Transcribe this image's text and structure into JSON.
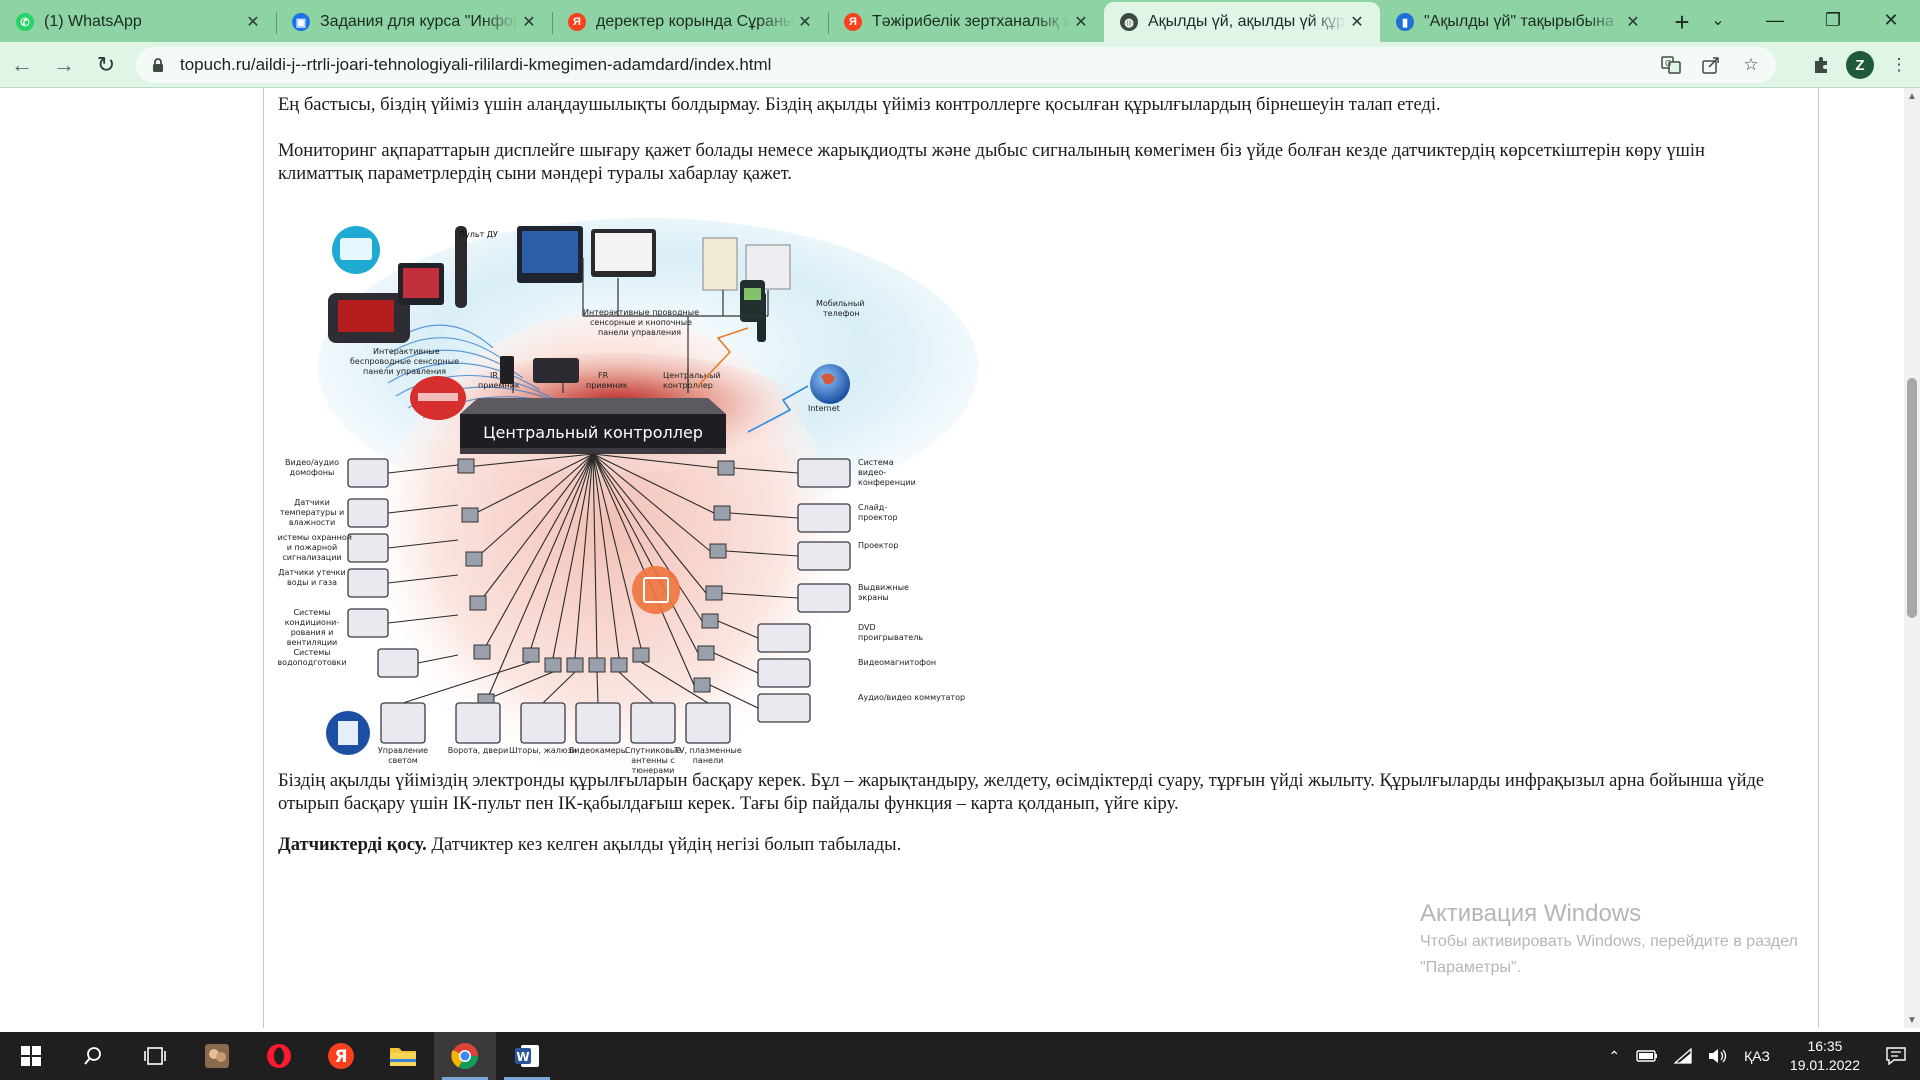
{
  "browser": {
    "tabs": [
      {
        "title": "(1) WhatsApp",
        "icon": "whatsapp-icon",
        "color": "#25d366",
        "glyph": "✆"
      },
      {
        "title": "Задания для курса \"Инфор",
        "icon": "classroom-icon",
        "color": "#1a73e8",
        "glyph": "▣"
      },
      {
        "title": "деректер корында Сұраны",
        "icon": "yandex-icon",
        "color": "#fc3f1d",
        "glyph": "Я"
      },
      {
        "title": "Тәжірибелік зертханалық ж",
        "icon": "yandex-icon",
        "color": "#fc3f1d",
        "glyph": "Я"
      },
      {
        "title": "Ақылды үй, ақылды үй құр",
        "icon": "globe-icon",
        "color": "#3c4a41",
        "glyph": "◍",
        "active": true
      },
      {
        "title": "\"Ақылды үй\" тақырыбына",
        "icon": "book-icon",
        "color": "#1e6fd9",
        "glyph": "▮"
      }
    ],
    "new_tab_label": "+",
    "url": "topuch.ru/aildi-j--rtrli-joari-tehnologiyali-rililardi-kmegimen-adamdard/index.html",
    "profile_initial": "Z"
  },
  "page": {
    "para1": "Ең бастысы, біздің үйіміз үшін алаңдаушылықты болдырмау. Біздің ақылды үйіміз контроллерге қосылған құрылғылардың бірнешеуін талап етеді.",
    "para2": "Мониторинг ақпараттарын дисплейге шығару қажет болады немесе жарықдиодты және дыбыс сигналының көмегімен біз үйде болған кезде датчиктердің көрсеткіштерін көру үшін климаттық параметрлердің сыни мәндері туралы хабарлау қажет.",
    "para3": "Біздің ақылды үйіміздің электронды құрылғыларын басқару керек. Бұл – жарықтандыру, желдету, өсімдіктерді суару, тұрғын үйді жылыту. Құрылғыларды инфрақызыл арна бойынша үйде отырып басқару үшін ІК-пульт пен ІК-қабылдағыш керек. Тағы бір пайдалы функция – карта қолданып, үйге кіру.",
    "para4_bold": "Датчиктерді қосу.",
    "para4_rest": " Датчиктер кез келген ақылды үйдің негізі болып табылады."
  },
  "diagram": {
    "controller": "Центральный контроллер",
    "remote": "Пульт ДУ",
    "wireless_panels": [
      "Интерактивные",
      "беспроводные сенсорные",
      "панели управления"
    ],
    "wired_panels": [
      "Интерактивные проводные",
      "сенсорные и кнопочные",
      "панели управления"
    ],
    "ir_receiver": [
      "IR",
      "приемник"
    ],
    "fr_receiver": [
      "FR",
      "приемник"
    ],
    "central_ctrl": [
      "Центральный",
      "контроллер"
    ],
    "mobile": [
      "Мобильный",
      "телефон"
    ],
    "internet": "Internet",
    "left": [
      [
        "Видео/аудио",
        "домофоны"
      ],
      [
        "Датчики",
        "температуры и",
        "влажности"
      ],
      [
        "Системы охранной",
        "и пожарной",
        "сигнализации"
      ],
      [
        "Датчики утечки",
        "воды и газа"
      ],
      [
        "Системы",
        "кондициони-",
        "рования и",
        "вентиляции"
      ],
      [
        "Системы",
        "водоподготовки"
      ]
    ],
    "right": [
      [
        "Система",
        "видео-",
        "конференции"
      ],
      [
        "Слайд-",
        "проектор"
      ],
      [
        "Проектор"
      ],
      [
        "Выдвижные",
        "экраны"
      ],
      [
        "DVD",
        "проигрыватель"
      ],
      [
        "Видеомагнитофон"
      ],
      [
        "Аудио/видео коммутатор"
      ]
    ],
    "bottom": [
      [
        "Управление",
        "светом"
      ],
      [
        "Ворота, двери"
      ],
      [
        "Шторы, жалюзи"
      ],
      [
        "Видеокамеры"
      ],
      [
        "Спутниковые",
        "антенны с",
        "тюнерами"
      ],
      [
        "TV, плазменные",
        "панели"
      ]
    ]
  },
  "watermark": {
    "title": "Активация Windows",
    "line1": "Чтобы активировать Windows, перейдите в раздел",
    "line2": "\"Параметры\"."
  },
  "taskbar": {
    "items": [
      "windows-start-icon",
      "search-icon",
      "task-view-icon",
      "app-icon",
      "opera-icon",
      "yandex-browser-icon",
      "file-explorer-icon",
      "chrome-icon",
      "word-icon"
    ],
    "language": "ҚАЗ",
    "time": "16:35",
    "date": "19.01.2022"
  }
}
